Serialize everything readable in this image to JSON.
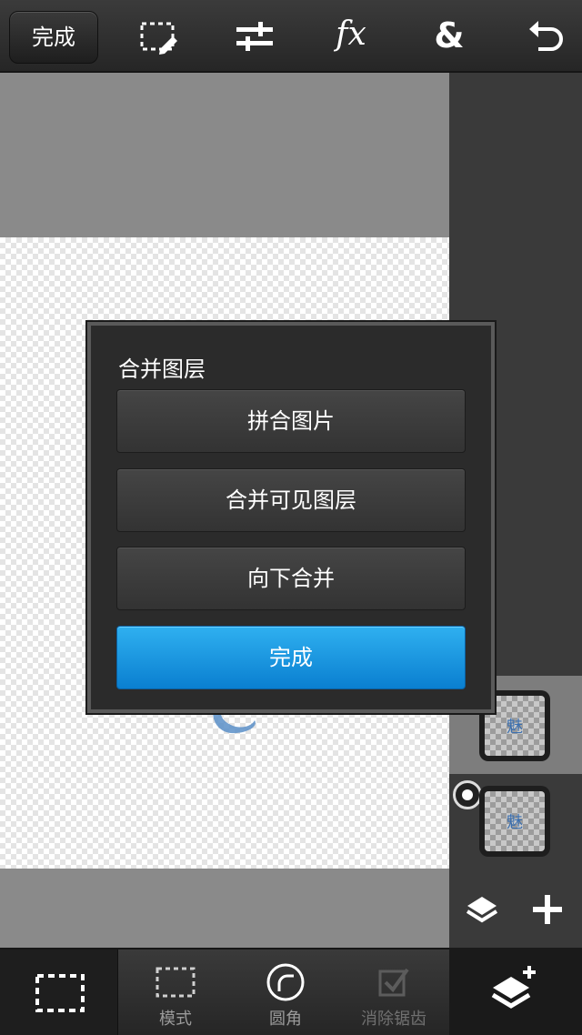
{
  "toolbar": {
    "done_label": "完成",
    "icons": [
      "selection-edit-icon",
      "adjustments-icon",
      "fx-icon",
      "ampersand-icon",
      "undo-icon"
    ],
    "fx_label": "fx",
    "amp_label": "&"
  },
  "dialog": {
    "title": "合并图层",
    "buttons": {
      "flatten": "拼合图片",
      "merge_visible": "合并可见图层",
      "merge_down": "向下合并",
      "done": "完成"
    }
  },
  "bottombar": {
    "mode": "模式",
    "round": "圆角",
    "antialias": "消除锯齿"
  },
  "layers": {
    "thumb1_text": "魅",
    "thumb2_text": "魅"
  },
  "colors": {
    "primary": "#1a95e0",
    "toolbar": "#2e2e2e",
    "canvas_gray": "#8a8a8a"
  }
}
